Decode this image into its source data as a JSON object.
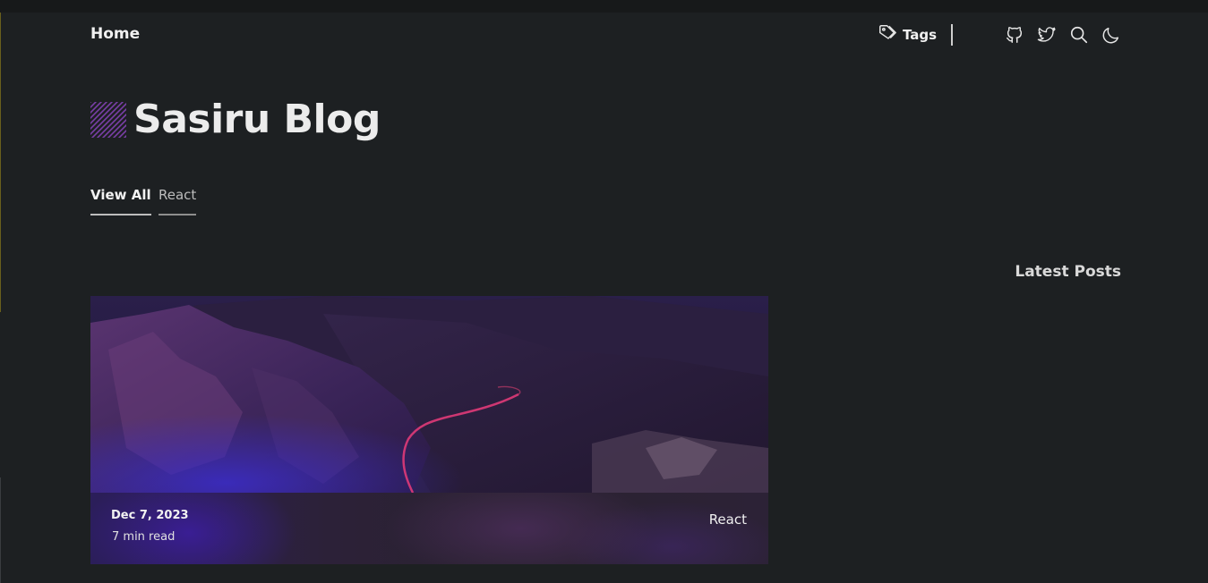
{
  "nav": {
    "home_label": "Home",
    "tags_label": "Tags",
    "icons": [
      "github-icon",
      "twitter-icon",
      "search-icon",
      "moon-icon"
    ]
  },
  "site": {
    "title": "Sasiru Blog"
  },
  "tabs": [
    {
      "label": "View All",
      "active": true
    },
    {
      "label": "React",
      "active": false
    }
  ],
  "sidebar": {
    "latest_posts_heading": "Latest Posts"
  },
  "posts": [
    {
      "date": "Dec 7, 2023",
      "read_time": "7 min read",
      "tag": "React"
    }
  ],
  "colors": {
    "background": "#1d2022",
    "accent": "#7a3fa8"
  }
}
